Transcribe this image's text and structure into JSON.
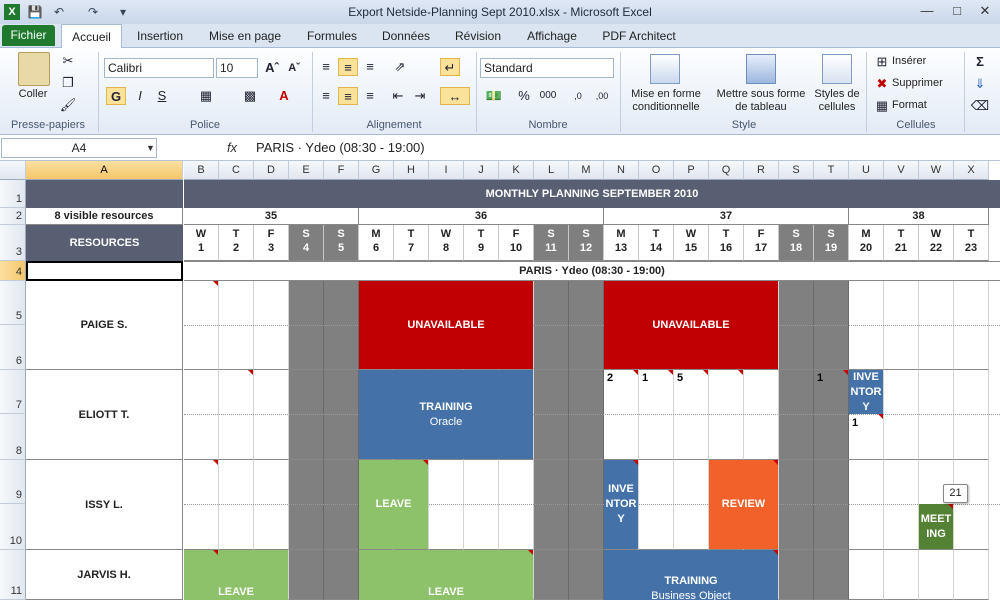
{
  "window": {
    "title": "Export Netside-Planning Sept 2010.xlsx  -  Microsoft Excel"
  },
  "tabs": [
    "Fichier",
    "Accueil",
    "Insertion",
    "Mise en page",
    "Formules",
    "Données",
    "Révision",
    "Affichage",
    "PDF Architect"
  ],
  "ribbon": {
    "clipboard": {
      "label": "Presse-papiers",
      "paste": "Coller"
    },
    "font": {
      "label": "Police",
      "name": "Calibri",
      "size": "10"
    },
    "alignment": {
      "label": "Alignement"
    },
    "number": {
      "label": "Nombre",
      "format": "Standard"
    },
    "style": {
      "label": "Style",
      "conditional": "Mise en forme conditionnelle",
      "table": "Mettre sous forme de tableau",
      "cellstyles": "Styles de cellules"
    },
    "cells": {
      "label": "Cellules",
      "insert": "Insérer",
      "delete": "Supprimer",
      "format": "Format"
    }
  },
  "formula_bar": {
    "namebox": "A4",
    "fx": "fx",
    "content": "PARIS · Ydeo  (08:30 - 19:00)"
  },
  "columns": [
    "A",
    "B",
    "C",
    "D",
    "E",
    "F",
    "G",
    "H",
    "I",
    "J",
    "K",
    "L",
    "M",
    "N",
    "O",
    "P",
    "Q",
    "R",
    "S",
    "T",
    "U",
    "V",
    "W",
    "X"
  ],
  "rows": [
    "1",
    "2",
    "3",
    "4",
    "5",
    "6",
    "7",
    "8",
    "9",
    "10",
    "11"
  ],
  "sheet": {
    "header": "MONTHLY PLANNING SEPTEMBER 2010",
    "visible_resources": "8 visible resources",
    "resources_label": "RESOURCES",
    "weeks": [
      "35",
      "36",
      "37",
      "38"
    ],
    "days": [
      {
        "l": "W",
        "n": "1"
      },
      {
        "l": "T",
        "n": "2"
      },
      {
        "l": "F",
        "n": "3"
      },
      {
        "l": "S",
        "n": "4"
      },
      {
        "l": "S",
        "n": "5"
      },
      {
        "l": "M",
        "n": "6"
      },
      {
        "l": "T",
        "n": "7"
      },
      {
        "l": "W",
        "n": "8"
      },
      {
        "l": "T",
        "n": "9"
      },
      {
        "l": "F",
        "n": "10"
      },
      {
        "l": "S",
        "n": "11"
      },
      {
        "l": "S",
        "n": "12"
      },
      {
        "l": "M",
        "n": "13"
      },
      {
        "l": "T",
        "n": "14"
      },
      {
        "l": "W",
        "n": "15"
      },
      {
        "l": "T",
        "n": "16"
      },
      {
        "l": "F",
        "n": "17"
      },
      {
        "l": "S",
        "n": "18"
      },
      {
        "l": "S",
        "n": "19"
      },
      {
        "l": "M",
        "n": "20"
      },
      {
        "l": "T",
        "n": "21"
      },
      {
        "l": "W",
        "n": "22"
      },
      {
        "l": "T",
        "n": "23"
      }
    ],
    "site": "PARIS · Ydeo  (08:30 - 19:00)",
    "resources": [
      "PAIGE S.",
      "ELIOTT T.",
      "ISSY L.",
      "JARVIS H."
    ],
    "events": {
      "unavailable": "UNAVAILABLE",
      "training": "TRAINING",
      "training_oracle": "Oracle",
      "training_bo": "Business Object",
      "leave": "LEAVE",
      "review": "REVIEW",
      "inventory": "INVEN\nTOR\nY",
      "inventory2": "INVE\nNTOR\nY",
      "meeting": "MEET\nING"
    },
    "counts": {
      "n13": "2",
      "n14": "1",
      "n15": "5",
      "n19": "1",
      "n20": "1"
    },
    "tooltip": "21"
  },
  "colors": {
    "excel_green": "#1f7a2e",
    "header_dark": "#595f73",
    "red": "#c00000",
    "blue": "#4472a8",
    "green": "#8dc26b",
    "orange": "#f3612a"
  }
}
